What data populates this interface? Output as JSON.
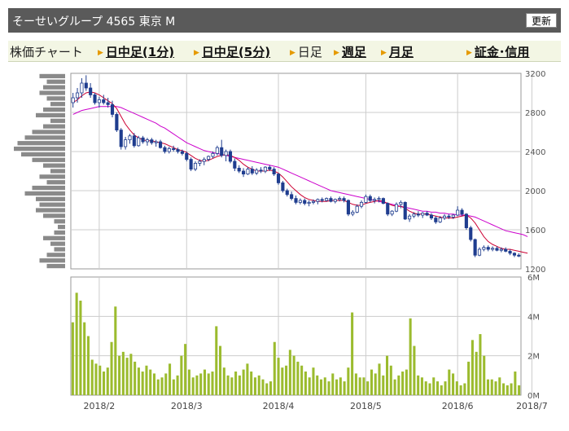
{
  "header": {
    "title": "そーせいグループ 4565 東京 M",
    "refresh_label": "更新"
  },
  "nav": {
    "chart_label": "株価チャート",
    "items": [
      {
        "label": "日中足(1分)",
        "link": true
      },
      {
        "label": "日中足(5分)",
        "link": true
      },
      {
        "label": "日足",
        "link": false
      },
      {
        "label": "週足",
        "link": true
      },
      {
        "label": "月足",
        "link": true
      },
      {
        "label": "証金･信用",
        "link": true
      }
    ]
  },
  "colors": {
    "up_candle": "#ffffff",
    "down_candle": "#1f3d8f",
    "ma_short": "#cc0033",
    "ma_long": "#cc00cc",
    "volume_bar": "#9bbb2e",
    "volume_profile": "#8a8a8a",
    "grid": "#cccccc"
  },
  "chart_data": [
    {
      "type": "candlestick",
      "ylim": [
        1200,
        3200
      ],
      "y_ticks": [
        "3200",
        "2800",
        "2400",
        "2000",
        "1600",
        "1200"
      ],
      "x_ticks": [
        "2018/2",
        "2018/3",
        "2018/4",
        "2018/5",
        "2018/6",
        "2018/7"
      ],
      "grid": true,
      "candles": [
        {
          "o": 2900,
          "h": 3000,
          "l": 2850,
          "c": 2950
        },
        {
          "o": 2950,
          "h": 3050,
          "l": 2900,
          "c": 3000
        },
        {
          "o": 3000,
          "h": 3150,
          "l": 2950,
          "c": 3100
        },
        {
          "o": 3100,
          "h": 3180,
          "l": 3020,
          "c": 3050
        },
        {
          "o": 3050,
          "h": 3100,
          "l": 2950,
          "c": 2980
        },
        {
          "o": 2980,
          "h": 3000,
          "l": 2880,
          "c": 2900
        },
        {
          "o": 2900,
          "h": 2960,
          "l": 2850,
          "c": 2930
        },
        {
          "o": 2930,
          "h": 2980,
          "l": 2880,
          "c": 2900
        },
        {
          "o": 2900,
          "h": 2950,
          "l": 2850,
          "c": 2880
        },
        {
          "o": 2880,
          "h": 2920,
          "l": 2750,
          "c": 2780
        },
        {
          "o": 2780,
          "h": 2800,
          "l": 2600,
          "c": 2620
        },
        {
          "o": 2620,
          "h": 2640,
          "l": 2420,
          "c": 2450
        },
        {
          "o": 2450,
          "h": 2550,
          "l": 2420,
          "c": 2520
        },
        {
          "o": 2520,
          "h": 2580,
          "l": 2480,
          "c": 2560
        },
        {
          "o": 2560,
          "h": 2590,
          "l": 2440,
          "c": 2460
        },
        {
          "o": 2460,
          "h": 2560,
          "l": 2450,
          "c": 2540
        },
        {
          "o": 2540,
          "h": 2560,
          "l": 2480,
          "c": 2500
        },
        {
          "o": 2500,
          "h": 2540,
          "l": 2460,
          "c": 2520
        },
        {
          "o": 2520,
          "h": 2540,
          "l": 2470,
          "c": 2490
        },
        {
          "o": 2490,
          "h": 2520,
          "l": 2450,
          "c": 2500
        },
        {
          "o": 2500,
          "h": 2520,
          "l": 2430,
          "c": 2440
        },
        {
          "o": 2440,
          "h": 2460,
          "l": 2380,
          "c": 2400
        },
        {
          "o": 2400,
          "h": 2450,
          "l": 2380,
          "c": 2430
        },
        {
          "o": 2430,
          "h": 2460,
          "l": 2400,
          "c": 2420
        },
        {
          "o": 2420,
          "h": 2440,
          "l": 2380,
          "c": 2400
        },
        {
          "o": 2400,
          "h": 2420,
          "l": 2360,
          "c": 2380
        },
        {
          "o": 2380,
          "h": 2400,
          "l": 2300,
          "c": 2320
        },
        {
          "o": 2320,
          "h": 2340,
          "l": 2200,
          "c": 2220
        },
        {
          "o": 2220,
          "h": 2300,
          "l": 2200,
          "c": 2280
        },
        {
          "o": 2280,
          "h": 2320,
          "l": 2250,
          "c": 2300
        },
        {
          "o": 2300,
          "h": 2340,
          "l": 2260,
          "c": 2320
        },
        {
          "o": 2320,
          "h": 2360,
          "l": 2300,
          "c": 2350
        },
        {
          "o": 2350,
          "h": 2400,
          "l": 2330,
          "c": 2380
        },
        {
          "o": 2380,
          "h": 2460,
          "l": 2360,
          "c": 2440
        },
        {
          "o": 2440,
          "h": 2520,
          "l": 2340,
          "c": 2360
        },
        {
          "o": 2360,
          "h": 2420,
          "l": 2300,
          "c": 2400
        },
        {
          "o": 2400,
          "h": 2420,
          "l": 2280,
          "c": 2300
        },
        {
          "o": 2300,
          "h": 2330,
          "l": 2200,
          "c": 2230
        },
        {
          "o": 2230,
          "h": 2260,
          "l": 2180,
          "c": 2200
        },
        {
          "o": 2200,
          "h": 2230,
          "l": 2140,
          "c": 2170
        },
        {
          "o": 2170,
          "h": 2240,
          "l": 2160,
          "c": 2220
        },
        {
          "o": 2220,
          "h": 2250,
          "l": 2160,
          "c": 2180
        },
        {
          "o": 2180,
          "h": 2230,
          "l": 2160,
          "c": 2210
        },
        {
          "o": 2210,
          "h": 2240,
          "l": 2180,
          "c": 2200
        },
        {
          "o": 2200,
          "h": 2250,
          "l": 2180,
          "c": 2240
        },
        {
          "o": 2240,
          "h": 2260,
          "l": 2200,
          "c": 2220
        },
        {
          "o": 2220,
          "h": 2240,
          "l": 2150,
          "c": 2170
        },
        {
          "o": 2170,
          "h": 2180,
          "l": 2060,
          "c": 2080
        },
        {
          "o": 2080,
          "h": 2100,
          "l": 1980,
          "c": 2000
        },
        {
          "o": 2000,
          "h": 2020,
          "l": 1940,
          "c": 1960
        },
        {
          "o": 1960,
          "h": 1990,
          "l": 1900,
          "c": 1920
        },
        {
          "o": 1920,
          "h": 1950,
          "l": 1860,
          "c": 1880
        },
        {
          "o": 1880,
          "h": 1920,
          "l": 1860,
          "c": 1900
        },
        {
          "o": 1900,
          "h": 1920,
          "l": 1850,
          "c": 1870
        },
        {
          "o": 1870,
          "h": 1900,
          "l": 1840,
          "c": 1880
        },
        {
          "o": 1880,
          "h": 1910,
          "l": 1860,
          "c": 1890
        },
        {
          "o": 1890,
          "h": 1920,
          "l": 1860,
          "c": 1910
        },
        {
          "o": 1910,
          "h": 1930,
          "l": 1880,
          "c": 1900
        },
        {
          "o": 1900,
          "h": 1930,
          "l": 1890,
          "c": 1920
        },
        {
          "o": 1920,
          "h": 1940,
          "l": 1880,
          "c": 1890
        },
        {
          "o": 1890,
          "h": 1920,
          "l": 1870,
          "c": 1910
        },
        {
          "o": 1910,
          "h": 1940,
          "l": 1890,
          "c": 1920
        },
        {
          "o": 1920,
          "h": 1940,
          "l": 1880,
          "c": 1900
        },
        {
          "o": 1900,
          "h": 1910,
          "l": 1740,
          "c": 1760
        },
        {
          "o": 1760,
          "h": 1800,
          "l": 1740,
          "c": 1780
        },
        {
          "o": 1780,
          "h": 1860,
          "l": 1770,
          "c": 1840
        },
        {
          "o": 1840,
          "h": 1900,
          "l": 1820,
          "c": 1880
        },
        {
          "o": 1880,
          "h": 1960,
          "l": 1870,
          "c": 1940
        },
        {
          "o": 1940,
          "h": 1960,
          "l": 1880,
          "c": 1900
        },
        {
          "o": 1900,
          "h": 1930,
          "l": 1870,
          "c": 1910
        },
        {
          "o": 1910,
          "h": 1940,
          "l": 1880,
          "c": 1920
        },
        {
          "o": 1920,
          "h": 1930,
          "l": 1860,
          "c": 1870
        },
        {
          "o": 1870,
          "h": 1880,
          "l": 1740,
          "c": 1760
        },
        {
          "o": 1760,
          "h": 1800,
          "l": 1740,
          "c": 1790
        },
        {
          "o": 1790,
          "h": 1880,
          "l": 1780,
          "c": 1860
        },
        {
          "o": 1860,
          "h": 1900,
          "l": 1820,
          "c": 1880
        },
        {
          "o": 1880,
          "h": 1890,
          "l": 1700,
          "c": 1710
        },
        {
          "o": 1710,
          "h": 1760,
          "l": 1680,
          "c": 1740
        },
        {
          "o": 1740,
          "h": 1780,
          "l": 1720,
          "c": 1760
        },
        {
          "o": 1760,
          "h": 1790,
          "l": 1730,
          "c": 1750
        },
        {
          "o": 1750,
          "h": 1780,
          "l": 1720,
          "c": 1770
        },
        {
          "o": 1770,
          "h": 1790,
          "l": 1740,
          "c": 1750
        },
        {
          "o": 1750,
          "h": 1770,
          "l": 1700,
          "c": 1720
        },
        {
          "o": 1720,
          "h": 1740,
          "l": 1660,
          "c": 1680
        },
        {
          "o": 1680,
          "h": 1740,
          "l": 1670,
          "c": 1720
        },
        {
          "o": 1720,
          "h": 1760,
          "l": 1700,
          "c": 1740
        },
        {
          "o": 1740,
          "h": 1760,
          "l": 1710,
          "c": 1730
        },
        {
          "o": 1730,
          "h": 1760,
          "l": 1710,
          "c": 1750
        },
        {
          "o": 1750,
          "h": 1840,
          "l": 1740,
          "c": 1800
        },
        {
          "o": 1800,
          "h": 1820,
          "l": 1740,
          "c": 1760
        },
        {
          "o": 1760,
          "h": 1770,
          "l": 1600,
          "c": 1620
        },
        {
          "o": 1620,
          "h": 1640,
          "l": 1480,
          "c": 1500
        },
        {
          "o": 1500,
          "h": 1510,
          "l": 1320,
          "c": 1340
        },
        {
          "o": 1340,
          "h": 1420,
          "l": 1330,
          "c": 1400
        },
        {
          "o": 1400,
          "h": 1440,
          "l": 1380,
          "c": 1420
        },
        {
          "o": 1420,
          "h": 1440,
          "l": 1380,
          "c": 1400
        },
        {
          "o": 1400,
          "h": 1430,
          "l": 1380,
          "c": 1410
        },
        {
          "o": 1410,
          "h": 1430,
          "l": 1380,
          "c": 1390
        },
        {
          "o": 1390,
          "h": 1420,
          "l": 1370,
          "c": 1400
        },
        {
          "o": 1400,
          "h": 1420,
          "l": 1370,
          "c": 1380
        },
        {
          "o": 1380,
          "h": 1400,
          "l": 1340,
          "c": 1360
        },
        {
          "o": 1360,
          "h": 1370,
          "l": 1320,
          "c": 1340
        },
        {
          "o": 1340,
          "h": 1360,
          "l": 1320,
          "c": 1330
        }
      ],
      "ma_short": [
        2900,
        2930,
        2970,
        3000,
        3010,
        3000,
        2980,
        2950,
        2920,
        2890,
        2840,
        2760,
        2680,
        2620,
        2570,
        2540,
        2520,
        2510,
        2510,
        2500,
        2490,
        2480,
        2460,
        2440,
        2420,
        2410,
        2390,
        2360,
        2330,
        2310,
        2300,
        2310,
        2330,
        2350,
        2360,
        2370,
        2360,
        2340,
        2310,
        2270,
        2240,
        2220,
        2200,
        2200,
        2200,
        2210,
        2200,
        2180,
        2140,
        2090,
        2040,
        2000,
        1960,
        1930,
        1910,
        1900,
        1890,
        1890,
        1890,
        1900,
        1900,
        1900,
        1900,
        1880,
        1860,
        1850,
        1850,
        1870,
        1880,
        1890,
        1900,
        1890,
        1870,
        1850,
        1840,
        1840,
        1820,
        1790,
        1770,
        1760,
        1760,
        1760,
        1750,
        1740,
        1730,
        1720,
        1720,
        1720,
        1730,
        1740,
        1750,
        1720,
        1670,
        1600,
        1530,
        1480,
        1450,
        1430,
        1410,
        1400,
        1400,
        1390,
        1380,
        1370,
        1360
      ],
      "ma_long": [
        2780,
        2800,
        2820,
        2830,
        2840,
        2850,
        2860,
        2860,
        2860,
        2860,
        2860,
        2850,
        2830,
        2810,
        2790,
        2770,
        2750,
        2730,
        2710,
        2690,
        2660,
        2640,
        2610,
        2580,
        2550,
        2520,
        2490,
        2470,
        2450,
        2430,
        2410,
        2400,
        2390,
        2380,
        2370,
        2360,
        2350,
        2340,
        2330,
        2320,
        2310,
        2300,
        2290,
        2280,
        2270,
        2260,
        2250,
        2240,
        2220,
        2200,
        2180,
        2160,
        2140,
        2120,
        2100,
        2080,
        2060,
        2040,
        2020,
        2000,
        1990,
        1980,
        1970,
        1960,
        1950,
        1940,
        1930,
        1920,
        1910,
        1900,
        1890,
        1880,
        1870,
        1860,
        1850,
        1840,
        1830,
        1820,
        1810,
        1800,
        1790,
        1790,
        1780,
        1780,
        1770,
        1770,
        1760,
        1760,
        1750,
        1750,
        1750,
        1740,
        1730,
        1710,
        1690,
        1670,
        1650,
        1630,
        1610,
        1590,
        1580,
        1570,
        1560,
        1550,
        1530
      ],
      "volume_profile": [
        2.5,
        3.5,
        2.5,
        1.5,
        2.0,
        3.0,
        1.5,
        1.0,
        1.5,
        3.0,
        4.0,
        3.5,
        4.0,
        5.5,
        4.5,
        2.5,
        3.5,
        2.0,
        3.0,
        4.5,
        6.0,
        7.0,
        6.5,
        5.5,
        4.5,
        3.0,
        2.0,
        4.0,
        3.0,
        2.0,
        2.5,
        3.5,
        3.0,
        2.5,
        3.5
      ]
    },
    {
      "type": "bar",
      "ylim": [
        0,
        6
      ],
      "y_ticks": [
        "6M",
        "4M",
        "2M",
        "0M"
      ],
      "volumes": [
        3.7,
        5.2,
        4.8,
        3.7,
        3.0,
        1.8,
        1.6,
        1.5,
        1.2,
        1.4,
        2.7,
        4.5,
        2.0,
        2.2,
        1.9,
        2.1,
        1.7,
        1.4,
        1.2,
        1.5,
        1.3,
        1.1,
        0.8,
        0.9,
        1.1,
        1.6,
        0.8,
        1.0,
        2.0,
        2.6,
        1.3,
        0.9,
        1.0,
        1.1,
        1.3,
        1.1,
        1.2,
        3.5,
        2.5,
        1.4,
        1.0,
        0.9,
        1.2,
        1.0,
        1.3,
        1.6,
        1.2,
        0.9,
        1.0,
        0.8,
        0.6,
        0.7,
        2.7,
        1.9,
        1.4,
        1.5,
        2.3,
        2.0,
        1.7,
        1.5,
        1.2,
        0.9,
        1.4,
        1.0,
        0.8,
        0.9,
        0.7,
        1.1,
        0.8,
        0.9,
        0.7,
        1.4,
        4.2,
        1.1,
        0.9,
        0.9,
        0.7,
        1.3,
        1.1,
        1.6,
        1.0,
        2.0,
        1.5,
        0.8,
        1.0,
        1.2,
        1.3,
        3.9,
        2.5,
        1.0,
        0.9,
        0.7,
        0.6,
        0.9,
        0.7,
        0.5,
        0.7,
        1.3,
        1.1,
        0.7,
        0.5,
        0.6,
        1.7,
        2.8,
        2.2,
        3.1,
        2.0,
        0.8,
        0.8,
        0.7,
        0.9,
        0.6,
        0.5,
        0.6,
        1.2,
        0.5
      ]
    }
  ]
}
